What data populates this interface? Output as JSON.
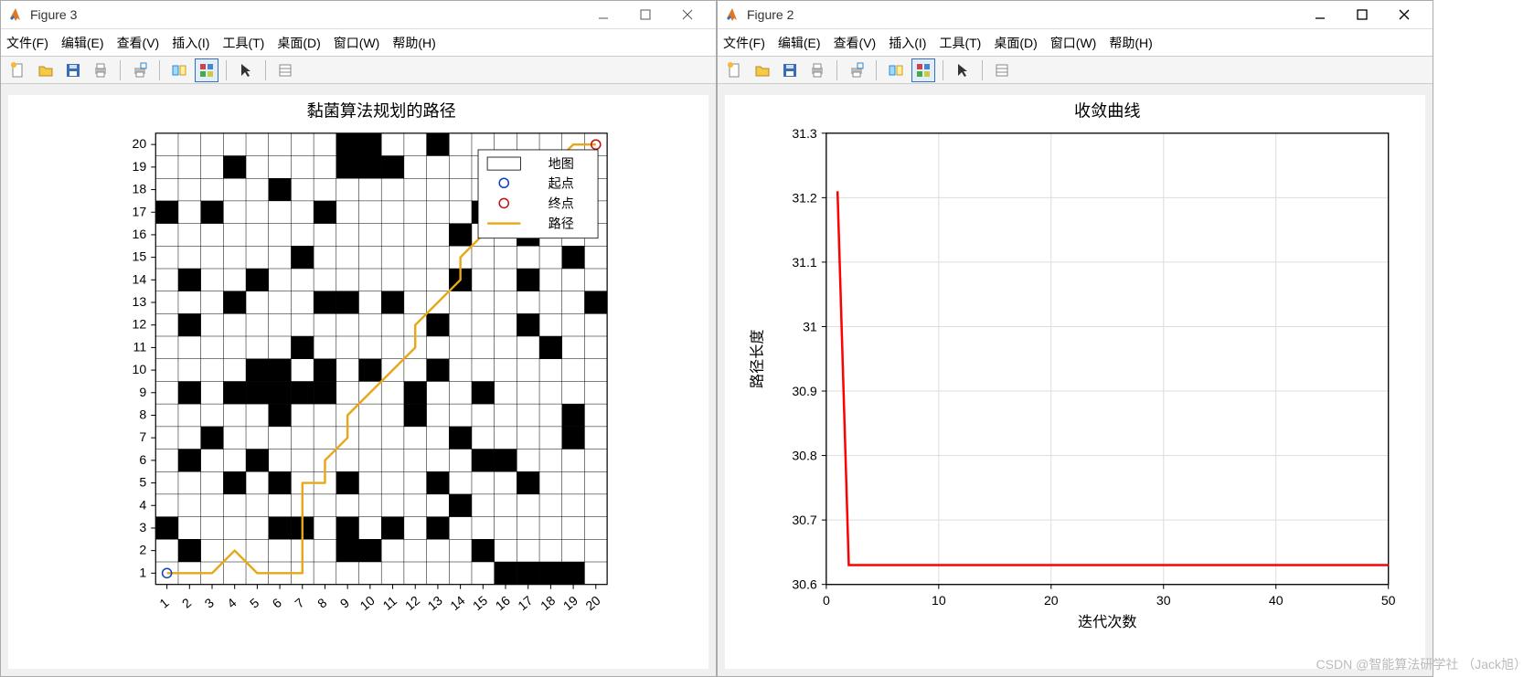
{
  "windows": [
    {
      "title": "Figure 3"
    },
    {
      "title": "Figure 2"
    }
  ],
  "menu": {
    "file": "文件(F)",
    "edit": "编辑(E)",
    "view": "查看(V)",
    "insert": "插入(I)",
    "tools": "工具(T)",
    "desktop": "桌面(D)",
    "window": "窗口(W)",
    "help": "帮助(H)"
  },
  "toolbar_icons": {
    "new": "new-file-icon",
    "open": "open-folder-icon",
    "save": "save-icon",
    "print": "print-icon",
    "printsel": "print-sel-icon",
    "linked": "linked-axes-icon",
    "brush": "brush-icon",
    "cursor": "cursor-icon",
    "insert": "insert-colorbar-icon"
  },
  "watermark": "CSDN @智能算法研学社 （Jack旭）",
  "chart_data": [
    {
      "type": "heatmap",
      "title": "黏菌算法规划的路径",
      "xlim": [
        1,
        20
      ],
      "ylim": [
        1,
        20
      ],
      "xticks": [
        1,
        2,
        3,
        4,
        5,
        6,
        7,
        8,
        9,
        10,
        11,
        12,
        13,
        14,
        15,
        16,
        17,
        18,
        19,
        20
      ],
      "yticks": [
        1,
        2,
        3,
        4,
        5,
        6,
        7,
        8,
        9,
        10,
        11,
        12,
        13,
        14,
        15,
        16,
        17,
        18,
        19,
        20
      ],
      "legend": {
        "map": "地图",
        "start": "起点",
        "goal": "终点",
        "path": "路径"
      },
      "start": [
        1,
        1
      ],
      "goal": [
        20,
        20
      ],
      "obstacles": [
        [
          2,
          2
        ],
        [
          9,
          2
        ],
        [
          10,
          2
        ],
        [
          15,
          2
        ],
        [
          1,
          3
        ],
        [
          6,
          3
        ],
        [
          7,
          3
        ],
        [
          9,
          3
        ],
        [
          11,
          3
        ],
        [
          13,
          3
        ],
        [
          14,
          4
        ],
        [
          4,
          5
        ],
        [
          6,
          5
        ],
        [
          9,
          5
        ],
        [
          13,
          5
        ],
        [
          17,
          5
        ],
        [
          2,
          6
        ],
        [
          5,
          6
        ],
        [
          15,
          6
        ],
        [
          16,
          6
        ],
        [
          3,
          7
        ],
        [
          14,
          7
        ],
        [
          19,
          7
        ],
        [
          6,
          8
        ],
        [
          12,
          8
        ],
        [
          19,
          8
        ],
        [
          2,
          9
        ],
        [
          4,
          9
        ],
        [
          5,
          9
        ],
        [
          6,
          9
        ],
        [
          7,
          9
        ],
        [
          8,
          9
        ],
        [
          12,
          9
        ],
        [
          15,
          9
        ],
        [
          5,
          10
        ],
        [
          6,
          10
        ],
        [
          8,
          10
        ],
        [
          10,
          10
        ],
        [
          13,
          10
        ],
        [
          7,
          11
        ],
        [
          18,
          11
        ],
        [
          2,
          12
        ],
        [
          13,
          12
        ],
        [
          17,
          12
        ],
        [
          4,
          13
        ],
        [
          8,
          13
        ],
        [
          9,
          13
        ],
        [
          11,
          13
        ],
        [
          20,
          13
        ],
        [
          2,
          14
        ],
        [
          5,
          14
        ],
        [
          14,
          14
        ],
        [
          17,
          14
        ],
        [
          7,
          15
        ],
        [
          19,
          15
        ],
        [
          14,
          16
        ],
        [
          17,
          16
        ],
        [
          1,
          17
        ],
        [
          3,
          17
        ],
        [
          8,
          17
        ],
        [
          15,
          17
        ],
        [
          19,
          17
        ],
        [
          6,
          18
        ],
        [
          17,
          18
        ],
        [
          4,
          19
        ],
        [
          11,
          19
        ],
        [
          13,
          20
        ]
      ],
      "path_big_black": [
        [
          16,
          1
        ],
        [
          17,
          1
        ],
        [
          18,
          1
        ],
        [
          19,
          1
        ],
        [
          9,
          19
        ],
        [
          10,
          19
        ],
        [
          9,
          20
        ],
        [
          10,
          20
        ]
      ],
      "path": [
        [
          1,
          1
        ],
        [
          2,
          1
        ],
        [
          3,
          1
        ],
        [
          4,
          2
        ],
        [
          5,
          1
        ],
        [
          6,
          1
        ],
        [
          7,
          1
        ],
        [
          7,
          2
        ],
        [
          7,
          3
        ],
        [
          7,
          4
        ],
        [
          7,
          5
        ],
        [
          8,
          5
        ],
        [
          8,
          6
        ],
        [
          9,
          7
        ],
        [
          9,
          8
        ],
        [
          10,
          9
        ],
        [
          11,
          10
        ],
        [
          12,
          11
        ],
        [
          12,
          12
        ],
        [
          13,
          13
        ],
        [
          14,
          14
        ],
        [
          14,
          15
        ],
        [
          15,
          16
        ],
        [
          15,
          17
        ],
        [
          16,
          17
        ],
        [
          17,
          18
        ],
        [
          18,
          19
        ],
        [
          19,
          20
        ],
        [
          20,
          20
        ]
      ],
      "path_color": "#e6a817"
    },
    {
      "type": "line",
      "title": "收敛曲线",
      "xlabel": "迭代次数",
      "ylabel": "路径长度",
      "xlim": [
        0,
        50
      ],
      "ylim": [
        30.6,
        31.3
      ],
      "xticks": [
        0,
        10,
        20,
        30,
        40,
        50
      ],
      "yticks": [
        30.6,
        30.7,
        30.8,
        30.9,
        31,
        31.1,
        31.2,
        31.3
      ],
      "series": [
        {
          "name": "convergence",
          "color": "#ff0000",
          "x": [
            1,
            2,
            3,
            5,
            10,
            20,
            30,
            40,
            50
          ],
          "values": [
            31.21,
            30.63,
            30.63,
            30.63,
            30.63,
            30.63,
            30.63,
            30.63,
            30.63
          ]
        }
      ]
    }
  ]
}
